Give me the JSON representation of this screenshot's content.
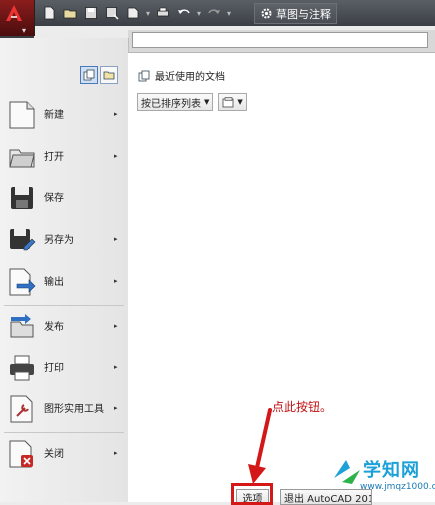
{
  "toolbar": {
    "workspace_label": "草图与注释"
  },
  "search": {
    "value": ""
  },
  "menu": {
    "items": [
      {
        "label": "新建",
        "arrow": "▸"
      },
      {
        "label": "打开",
        "arrow": "▸"
      },
      {
        "label": "保存",
        "arrow": ""
      },
      {
        "label": "另存为",
        "arrow": "▸"
      },
      {
        "label": "输出",
        "arrow": "▸"
      },
      {
        "label": "发布",
        "arrow": "▸"
      },
      {
        "label": "打印",
        "arrow": "▸"
      },
      {
        "label": "图形实用工具",
        "arrow": "▸"
      },
      {
        "label": "关闭",
        "arrow": "▸"
      }
    ]
  },
  "recent": {
    "title": "最近使用的文档",
    "sort_label": "按已排序列表"
  },
  "buttons": {
    "options_label": "选项",
    "exit_label": "退出 AutoCAD 201"
  },
  "annotation": {
    "text": "点此按钮。"
  },
  "watermark": {
    "title": "学知网",
    "url": "www.jmqz1000.com"
  },
  "colors": {
    "highlight": "#d41818",
    "annotation": "#c01010",
    "watermark": "#1da1d8"
  }
}
